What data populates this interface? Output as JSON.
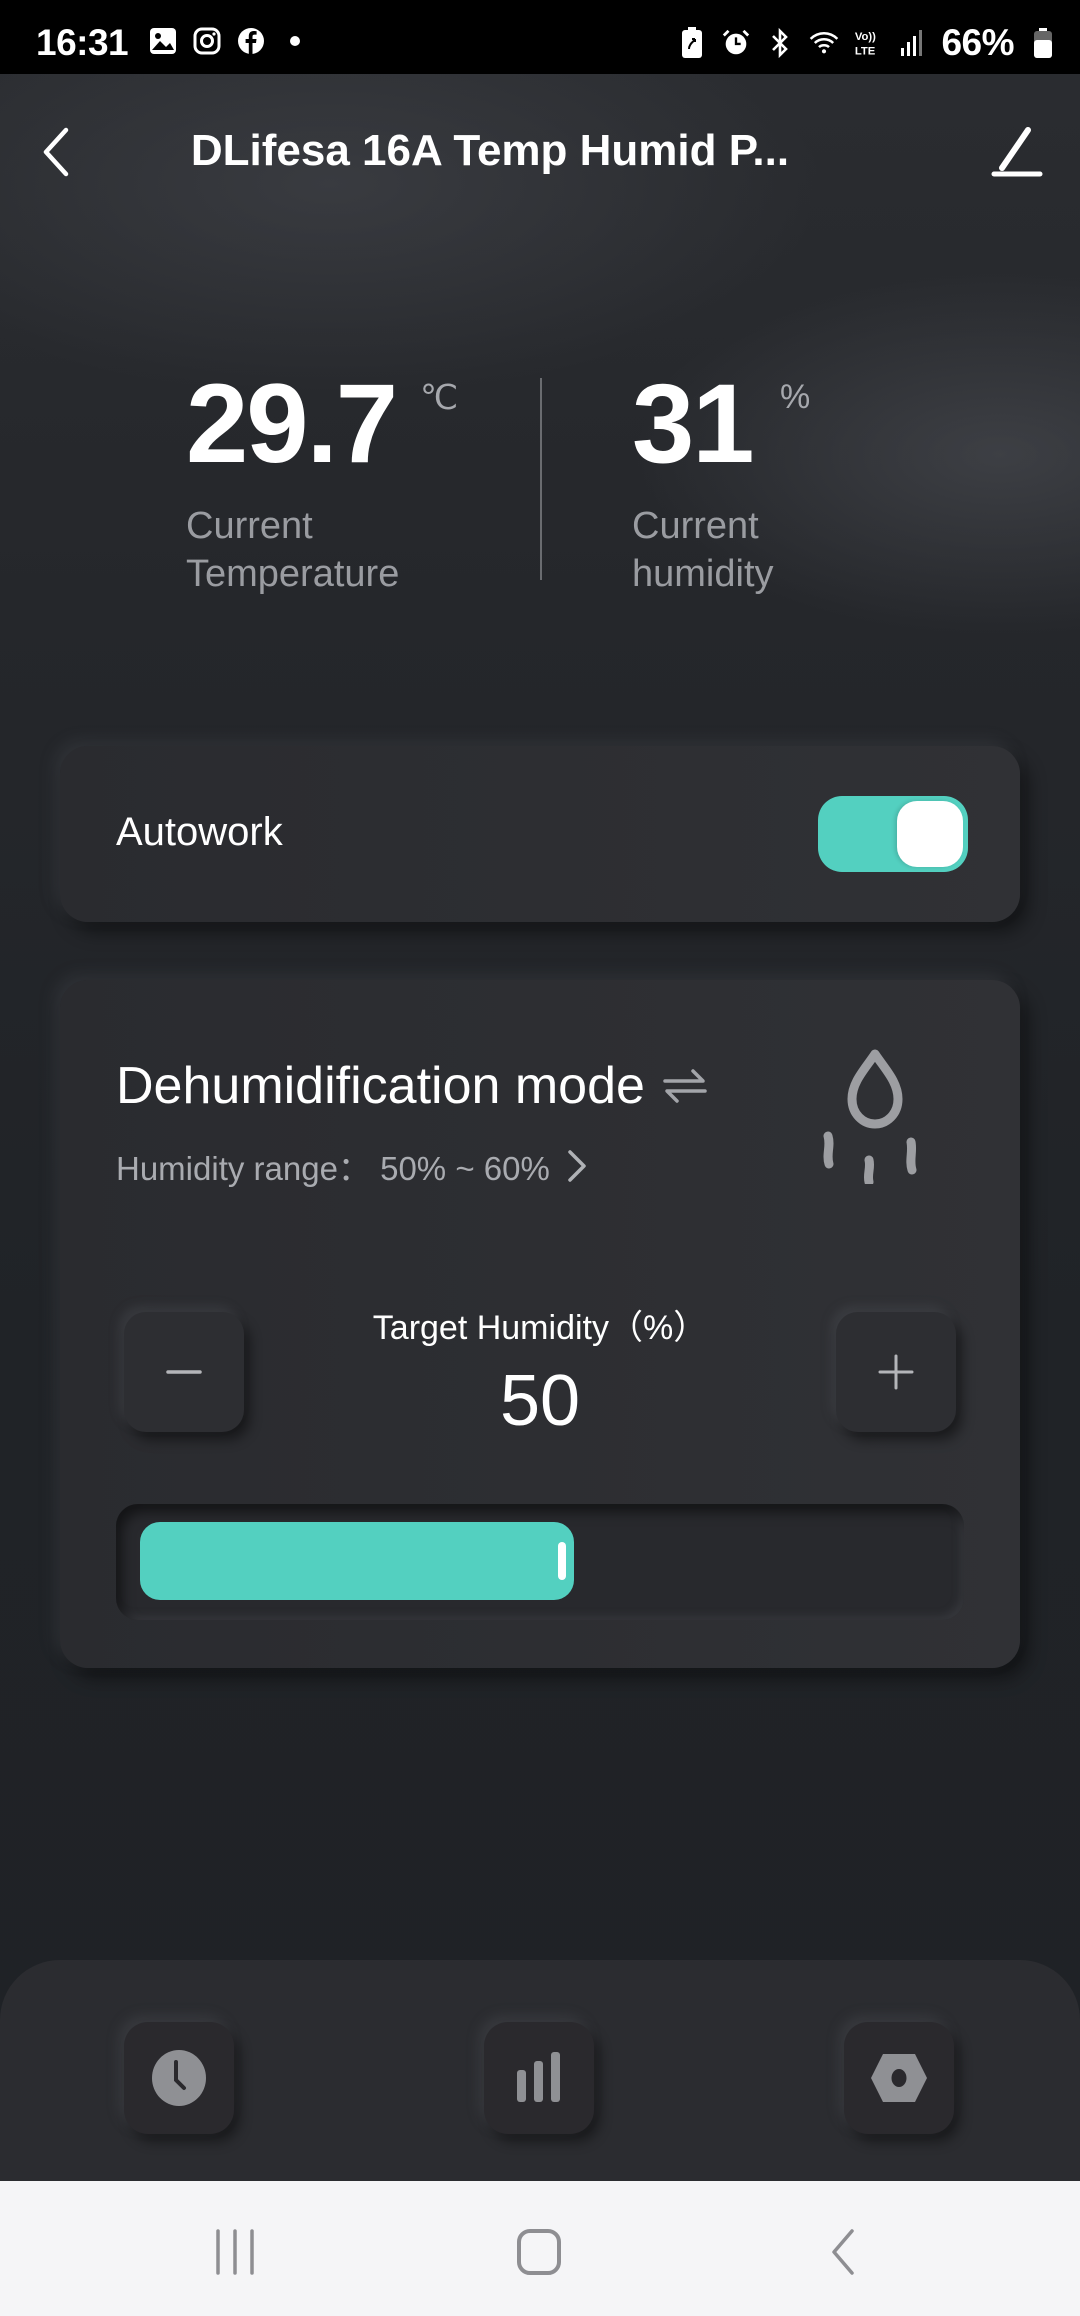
{
  "status_bar": {
    "time": "16:31",
    "left_icons": [
      "gallery-icon",
      "instagram-icon",
      "facebook-icon",
      "dot-icon"
    ],
    "right_icons": [
      "battery-saver-icon",
      "alarm-icon",
      "bluetooth-icon",
      "wifi-icon",
      "volte-icon",
      "signal-icon"
    ],
    "battery_percent": "66%"
  },
  "header": {
    "title": "DLifesa 16A Temp Humid P...",
    "back_icon": "chevron-left-icon",
    "edit_icon": "pencil-icon"
  },
  "readings": {
    "temperature": {
      "value": "29.7",
      "unit": "℃",
      "label_line1": "Current",
      "label_line2": "Temperature"
    },
    "humidity": {
      "value": "31",
      "unit": "%",
      "label_line1": "Current",
      "label_line2": "humidity"
    }
  },
  "autowork": {
    "label": "Autowork",
    "enabled": true
  },
  "mode_card": {
    "title": "Dehumidification mode",
    "switch_icon": "swap-arrows-icon",
    "range_label": "Humidity range： 50% ~ 60%",
    "mode_icon": "water-drop-icon",
    "target_label": "Target Humidity（%）",
    "target_value": "50",
    "slider_fraction": 0.5,
    "minus_label": "−",
    "plus_label": "+"
  },
  "dock": {
    "items": [
      {
        "name": "schedule",
        "icon": "clock-icon"
      },
      {
        "name": "statistics",
        "icon": "bar-chart-icon"
      },
      {
        "name": "settings",
        "icon": "hex-nut-icon"
      }
    ]
  },
  "system_nav": {
    "items": [
      "recent-apps-icon",
      "home-icon",
      "back-icon"
    ]
  },
  "colors": {
    "accent": "#53d0c0",
    "background": "#1f2226",
    "card": "#2d2e32",
    "text_secondary": "#9a9ca1"
  }
}
